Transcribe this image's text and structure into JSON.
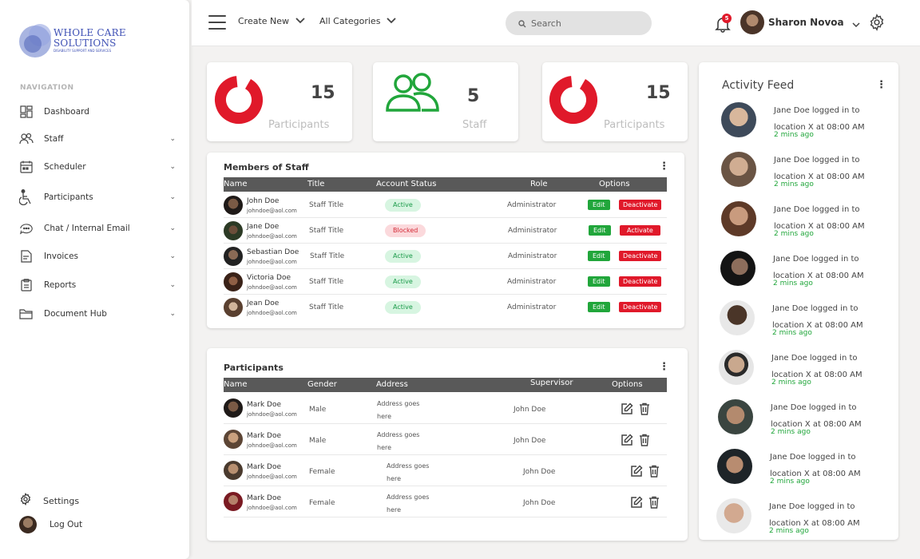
{
  "brand": {
    "line1": "WHOLE CARE",
    "line2": "SOLUTIONS",
    "tagline": "DISABILITY SUPPORT AND SERVICES"
  },
  "sidebar": {
    "heading": "NAVIGATION",
    "items": [
      {
        "label": "Dashboard",
        "icon": "dashboard-icon"
      },
      {
        "label": "Staff",
        "icon": "users-icon"
      },
      {
        "label": "Scheduler",
        "icon": "calendar-icon"
      },
      {
        "label": "Participants",
        "icon": "wheelchair-icon"
      },
      {
        "label": "Chat / Internal Email",
        "icon": "chat-icon"
      },
      {
        "label": "Invoices",
        "icon": "invoice-icon"
      },
      {
        "label": "Reports",
        "icon": "clipboard-icon"
      },
      {
        "label": "Document Hub",
        "icon": "folder-icon"
      }
    ],
    "settings_label": "Settings",
    "logout_label": "Log Out"
  },
  "topbar": {
    "create_new": "Create New",
    "all_categories": "All Categories",
    "search_placeholder": "Search",
    "notification_count": "5",
    "user_name": "Sharon Novoa"
  },
  "stats": [
    {
      "value": "15",
      "label": "Participants"
    },
    {
      "value": "5",
      "label": "Staff"
    },
    {
      "value": "15",
      "label": "Participants"
    }
  ],
  "staff_table": {
    "title": "Members of Staff",
    "headers": {
      "name": "Name",
      "title": "Title",
      "status": "Account Status",
      "role": "Role",
      "options": "Options"
    },
    "rows": [
      {
        "name": "John Doe",
        "email": "johndoe@aol.com",
        "title": "Staff Title",
        "status": "Active",
        "role": "Administrator",
        "edit": "Edit",
        "action": "Deactivate"
      },
      {
        "name": "Jane Doe",
        "email": "johndoe@aol.com",
        "title": "Staff Title",
        "status": "Blocked",
        "role": "Administrator",
        "edit": "Edit",
        "action": "Activate"
      },
      {
        "name": "Sebastian Doe",
        "email": "johndoe@aol.com",
        "title": "Staff Title",
        "status": "Active",
        "role": "Administrator",
        "edit": "Edit",
        "action": "Deactivate"
      },
      {
        "name": "Victoria Doe",
        "email": "johndoe@aol.com",
        "title": "Staff Title",
        "status": "Active",
        "role": "Administrator",
        "edit": "Edit",
        "action": "Deactivate"
      },
      {
        "name": "Jean Doe",
        "email": "johndoe@aol.com",
        "title": "Staff Title",
        "status": "Active",
        "role": "Administrator",
        "edit": "Edit",
        "action": "Deactivate"
      }
    ]
  },
  "participants_table": {
    "title": "Participants",
    "headers": {
      "name": "Name",
      "gender": "Gender",
      "address": "Address",
      "supervisor": "Supervisor",
      "options": "Options"
    },
    "rows": [
      {
        "name": "Mark Doe",
        "email": "johndoe@aol.com",
        "gender": "Male",
        "address_l1": "Address goes",
        "address_l2": "here",
        "supervisor": "John Doe"
      },
      {
        "name": "Mark Doe",
        "email": "johndoe@aol.com",
        "gender": "Male",
        "address_l1": "Address goes",
        "address_l2": "here",
        "supervisor": "John Doe"
      },
      {
        "name": "Mark Doe",
        "email": "johndoe@aol.com",
        "gender": "Female",
        "address_l1": "Address goes",
        "address_l2": "here",
        "supervisor": "John Doe"
      },
      {
        "name": "Mark Doe",
        "email": "johndoe@aol.com",
        "gender": "Female",
        "address_l1": "Address goes",
        "address_l2": "here",
        "supervisor": "John Doe"
      }
    ]
  },
  "activity_feed": {
    "title": "Activity Feed",
    "items": [
      {
        "text": "Jane Doe logged in to location X at 08:00 AM",
        "ago": "2 mins ago"
      },
      {
        "text": "Jane Doe logged in to location X at 08:00 AM",
        "ago": "2 mins ago"
      },
      {
        "text": "Jane Doe logged in to location X at 08:00 AM",
        "ago": "2 mins ago"
      },
      {
        "text": "Jane Doe logged in to location X at 08:00 AM",
        "ago": "2 mins ago"
      },
      {
        "text": "Jane Doe logged in to location X at 08:00 AM",
        "ago": "2 mins ago"
      },
      {
        "text": "Jane Doe logged in to location X at 08:00 AM",
        "ago": "2 mins ago"
      },
      {
        "text": "Jane Doe logged in to location X at 08:00 AM",
        "ago": "2 mins ago"
      },
      {
        "text": "Jane Doe logged in to location X at 08:00 AM",
        "ago": "2 mins ago"
      },
      {
        "text": "Jane Doe logged in to location X at 08:00 AM",
        "ago": "2 mins ago"
      }
    ]
  },
  "colors": {
    "accent_red": "#e0192a",
    "accent_green": "#21a63b",
    "header_gray": "#595959",
    "brand_blue": "#3f51b5"
  }
}
